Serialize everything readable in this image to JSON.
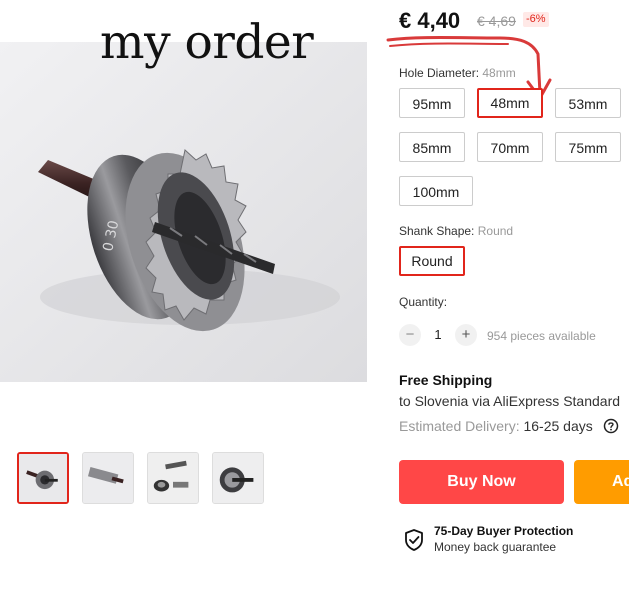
{
  "overlay_note": "my order",
  "price": {
    "current": "€ 4,40",
    "original": "€ 4,69",
    "discount": "-6%"
  },
  "hole_diameter": {
    "label": "Hole Diameter: ",
    "selected": "48mm",
    "options": [
      "95mm",
      "48mm",
      "53mm",
      "85mm",
      "70mm",
      "75mm",
      "100mm"
    ]
  },
  "shank_shape": {
    "label": "Shank Shape: ",
    "selected": "Round",
    "options": [
      "Round"
    ]
  },
  "quantity": {
    "label": "Quantity:",
    "decrement": "−",
    "increment": "+",
    "value": "1",
    "available": "954 pieces available"
  },
  "shipping": {
    "title": "Free Shipping",
    "detail": "to Slovenia via AliExpress Standard",
    "delivery_label": "Estimated Delivery: ",
    "delivery_days": "16-25 days"
  },
  "actions": {
    "buy_now": "Buy Now",
    "add_to_cart": "Add to Cart"
  },
  "protection": {
    "title": "75-Day Buyer Protection",
    "subtitle": "Money back guarantee"
  },
  "colors": {
    "accent": "#e1251b",
    "buy_now": "#ff4747",
    "add_to_cart": "#ff9c00",
    "annotation": "#d93a3a"
  },
  "icons": [
    "shield-icon",
    "help-icon",
    "annotation-arrow"
  ]
}
